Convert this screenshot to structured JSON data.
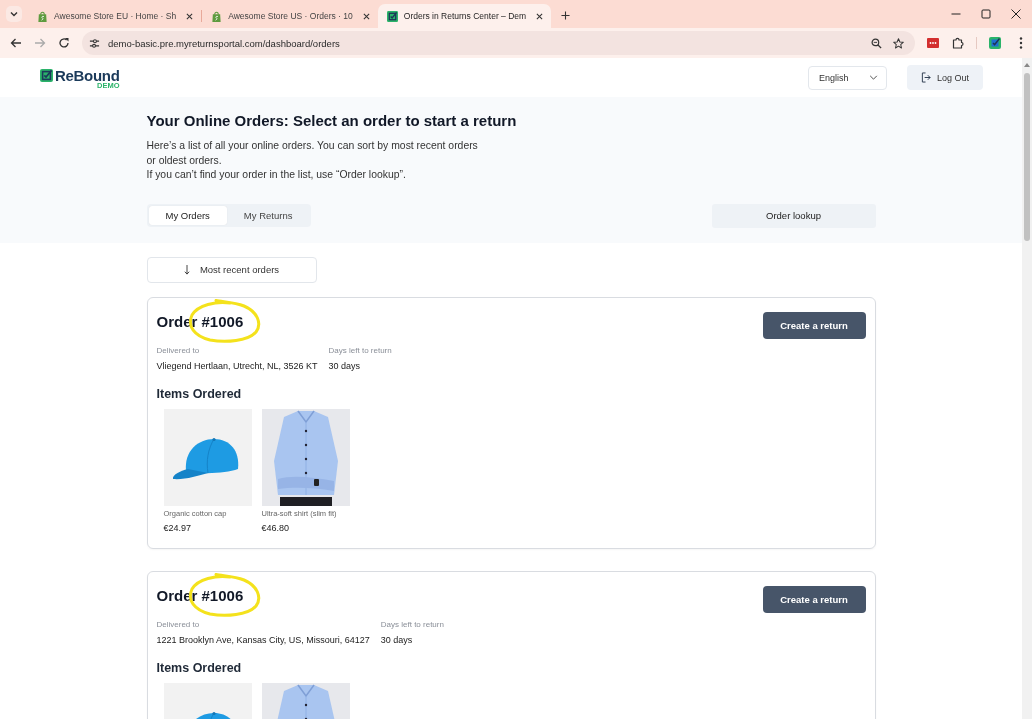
{
  "browser": {
    "tabs": [
      {
        "title": "Awesome Store EU · Home · Sh",
        "kind": "shop",
        "selected": false
      },
      {
        "title": "Awesome Store US · Orders · 10",
        "kind": "shop",
        "selected": false
      },
      {
        "title": "Orders in Returns Center – Dem",
        "kind": "portal",
        "selected": true
      }
    ],
    "url": "demo-basic.pre.myreturnsportal.com/dashboard/orders"
  },
  "header": {
    "logo": {
      "name": "ReBound",
      "badge": "DEMO"
    },
    "language": "English",
    "logout": "Log Out"
  },
  "hero": {
    "title": "Your Online Orders: Select an order to start a return",
    "description": "Here’s a list of all your online orders. You can sort by most recent orders or oldest orders.",
    "hint": "If you can’t find your order in the list, use “Order lookup”.",
    "tabs": [
      {
        "label": "My Orders",
        "selected": true
      },
      {
        "label": "My Returns",
        "selected": false
      }
    ],
    "lookup_button": "Order lookup"
  },
  "sort": {
    "label": "Most recent orders"
  },
  "orders": [
    {
      "number": "Order #1006",
      "circled": true,
      "button": "Create a return",
      "fields": [
        {
          "label": "Delivered to",
          "value": "Vliegend Hertlaan, Utrecht, NL, 3526 KT"
        },
        {
          "label": "Days left to return",
          "value": "30 days"
        }
      ],
      "items_title": "Items Ordered",
      "items": [
        {
          "kind": "cap",
          "name": "Organic cotton cap",
          "price": "€24.97"
        },
        {
          "kind": "shirt",
          "name": "Ultra-soft shirt (slim fit)",
          "price": "€46.80"
        }
      ]
    },
    {
      "number": "Order #1006",
      "circled": true,
      "button": "Create a return",
      "fields": [
        {
          "label": "Delivered to",
          "value": "1221 Brooklyn Ave, Kansas City, US, Missouri, 64127"
        },
        {
          "label": "Days left to return",
          "value": "30 days"
        }
      ],
      "items_title": "Items Ordered",
      "items": [
        {
          "kind": "cap"
        },
        {
          "kind": "shirt"
        }
      ]
    }
  ]
}
